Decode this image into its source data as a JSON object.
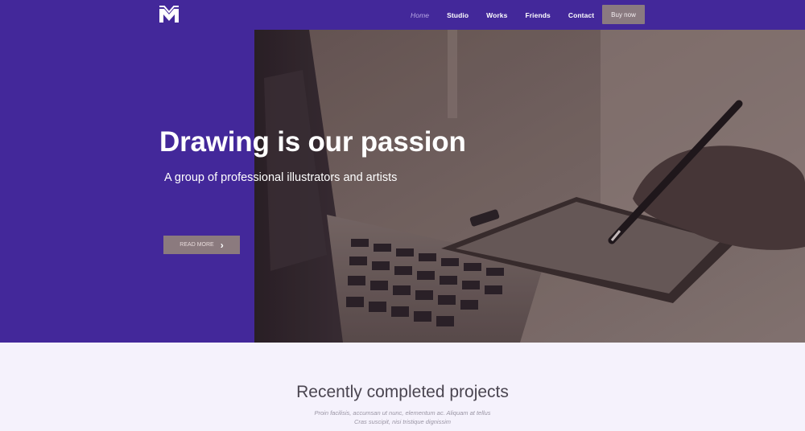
{
  "nav": {
    "items": [
      {
        "label": "Home"
      },
      {
        "label": "Studio"
      },
      {
        "label": "Works"
      },
      {
        "label": "Friends"
      },
      {
        "label": "Contact"
      }
    ],
    "buy_label": "Buy now"
  },
  "hero": {
    "title": "Drawing is our passion",
    "subtitle": "A group of professional illustrators and artists",
    "cta_label": "READ MORE"
  },
  "projects": {
    "title": "Recently completed projects",
    "desc_line1": "Proin facilisis, accumsan ut nunc, elementum ac. Aliquam at tellus",
    "desc_line2": "Cras suscipit, nisi tristique dignissim"
  },
  "colors": {
    "brand": "#43289a",
    "button": "#8a7a80",
    "section_bg": "#f5f2fc"
  }
}
